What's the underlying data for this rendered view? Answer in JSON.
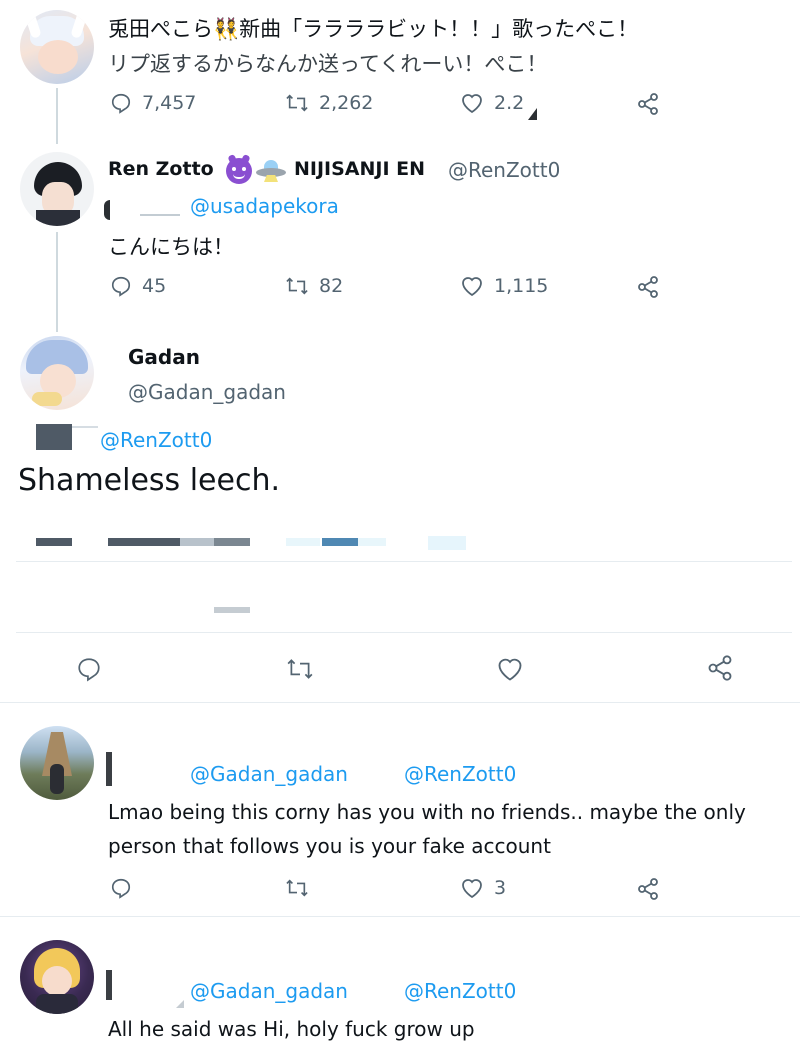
{
  "tweet1": {
    "text_line1": "兎田ぺこら👯新曲「ララララビット！！」歌ったぺこ！",
    "text_line2": "リプ返するからなんか送ってくれーい！ぺこ！",
    "replies": "7,457",
    "retweets": "2,262",
    "likes": "2.2"
  },
  "tweet2": {
    "name": "Ren Zotto",
    "org": "NIJISANJI EN",
    "handle": "@RenZott0",
    "reply_to": "@usadapekora",
    "text": "こんにちは！",
    "replies": "45",
    "retweets": "82",
    "likes": "1,115"
  },
  "main_tweet": {
    "name": "Gadan",
    "handle": "@Gadan_gadan",
    "reply_to": "@RenZott0",
    "text": "Shameless leech."
  },
  "reply1": {
    "mention1": "@Gadan_gadan",
    "mention2": "@RenZott0",
    "text_line1": "Lmao being this corny has you with no friends.. maybe the only",
    "text_line2": "person that follows you is your fake account",
    "likes": "3"
  },
  "reply2": {
    "mention1": "@Gadan_gadan",
    "mention2": "@RenZott0",
    "text": "All he said was Hi, holy fuck grow up"
  },
  "colors": {
    "link": "#1d9bf0",
    "muted": "#536471",
    "text": "#0f1419",
    "divider": "#e6ecf0"
  }
}
